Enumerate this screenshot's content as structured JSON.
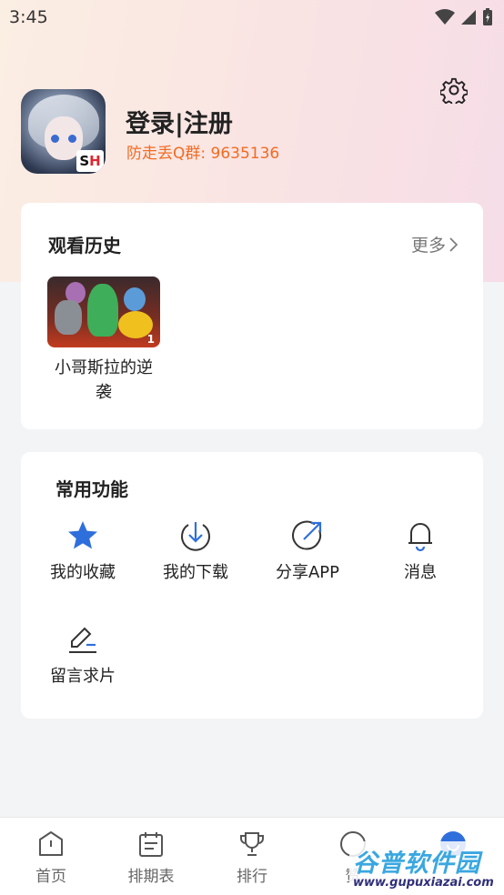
{
  "status_bar": {
    "time": "3:45"
  },
  "profile": {
    "login_label": "登录|注册",
    "qq_group": "防走丢Q群: 9635136",
    "avatar_logo_s": "S",
    "avatar_logo_h": "H"
  },
  "history": {
    "title": "观看历史",
    "more_label": "更多",
    "items": [
      {
        "title": "小哥斯拉的逆袭",
        "badge": "1"
      }
    ]
  },
  "functions": {
    "title": "常用功能",
    "items": [
      {
        "label": "我的收藏",
        "icon": "star-icon"
      },
      {
        "label": "我的下载",
        "icon": "download-icon"
      },
      {
        "label": "分享APP",
        "icon": "share-icon"
      },
      {
        "label": "消息",
        "icon": "bell-icon"
      },
      {
        "label": "留言求片",
        "icon": "edit-icon"
      }
    ]
  },
  "bottom_nav": {
    "items": [
      {
        "label": "首页",
        "icon": "home-icon"
      },
      {
        "label": "排期表",
        "icon": "calendar-icon"
      },
      {
        "label": "排行",
        "icon": "trophy-icon"
      },
      {
        "label": "赞",
        "icon": "play-circle-icon"
      },
      {
        "label": "",
        "icon": "profile-icon"
      }
    ]
  },
  "watermark": {
    "text": "谷普软件园",
    "url": "www.gupuxiazai.com"
  },
  "colors": {
    "accent_blue": "#2f6fdc",
    "qq_orange": "#f26b22",
    "active_tab": "#2f6fdc"
  }
}
